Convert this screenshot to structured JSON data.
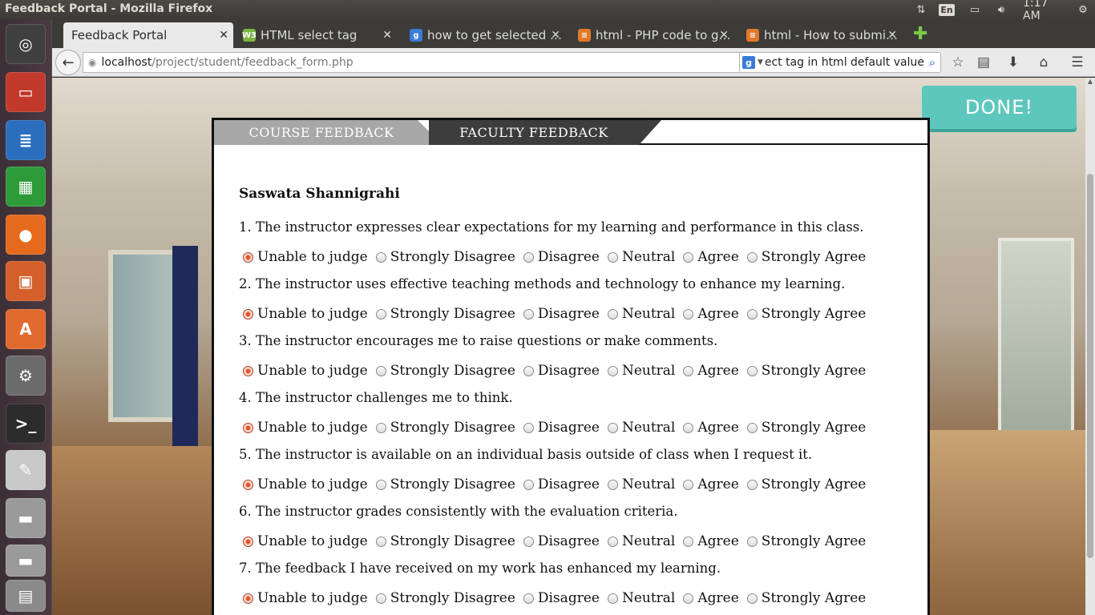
{
  "system": {
    "window_title": "Feedback Portal - Mozilla Firefox",
    "lang": "En",
    "clock": "1:17 AM"
  },
  "launcher": {
    "items": [
      {
        "name": "ubuntu-dash-icon",
        "glyph": "◎",
        "color": "#3f3f3f"
      },
      {
        "name": "files-icon",
        "glyph": "▭",
        "color": "#c0392b"
      },
      {
        "name": "writer-icon",
        "glyph": "≣",
        "color": "#2a6ebd"
      },
      {
        "name": "calc-icon",
        "glyph": "▦",
        "color": "#2e9b3a"
      },
      {
        "name": "firefox-icon",
        "glyph": "●",
        "color": "#e56a1d"
      },
      {
        "name": "impress-icon",
        "glyph": "▣",
        "color": "#d35f2a"
      },
      {
        "name": "software-center-icon",
        "glyph": "A",
        "color": "#e06a2e"
      },
      {
        "name": "settings-icon",
        "glyph": "⚙",
        "color": "#6b6b6b"
      },
      {
        "name": "terminal-icon",
        "glyph": ">_",
        "color": "#2c2c2c"
      },
      {
        "name": "text-editor-icon",
        "glyph": "✎",
        "color": "#c8c8c8"
      },
      {
        "name": "drive-1-icon",
        "glyph": "▬",
        "color": "#9a9a9a"
      },
      {
        "name": "drive-2-icon",
        "glyph": "▬",
        "color": "#9a9a9a"
      },
      {
        "name": "trash-icon",
        "glyph": "▤",
        "color": "#8a8a8a"
      }
    ]
  },
  "browser": {
    "tabs": [
      {
        "label": "Feedback Portal",
        "active": true
      },
      {
        "label": "HTML select tag",
        "active": false,
        "fav": "W3",
        "fav_color": "#7cb342"
      },
      {
        "label": "how to get selected …",
        "active": false,
        "fav": "g",
        "fav_color": "#3a7bd5"
      },
      {
        "label": "html - PHP code to g…",
        "active": false,
        "fav": "≡",
        "fav_color": "#e0782a"
      },
      {
        "label": "html - How to submi…",
        "active": false,
        "fav": "≡",
        "fav_color": "#e0782a"
      }
    ],
    "url_host": "localhost",
    "url_path": "/project/student/feedback_form.php",
    "search_value": "select tag in html default value"
  },
  "page": {
    "done_label": "DONE!",
    "tab_course": "COURSE FEEDBACK",
    "tab_faculty": "FACULTY FEEDBACK",
    "faculty_name": "Saswata Shannigrahi",
    "options": [
      "Unable to judge",
      "Strongly Disagree",
      "Disagree",
      "Neutral",
      "Agree",
      "Strongly Agree"
    ],
    "selected_option": "Unable to judge",
    "questions": [
      "1. The instructor expresses clear expectations for my learning and performance in this class.",
      "2. The instructor uses effective teaching methods and technology to enhance my learning.",
      "3. The instructor encourages me to raise questions or make comments.",
      "4. The instructor challenges me to think.",
      "5. The instructor is available on an individual basis outside of class when I request it.",
      "6. The instructor grades consistently with the evaluation criteria.",
      "7. The feedback I have received on my work has enhanced my learning."
    ]
  }
}
